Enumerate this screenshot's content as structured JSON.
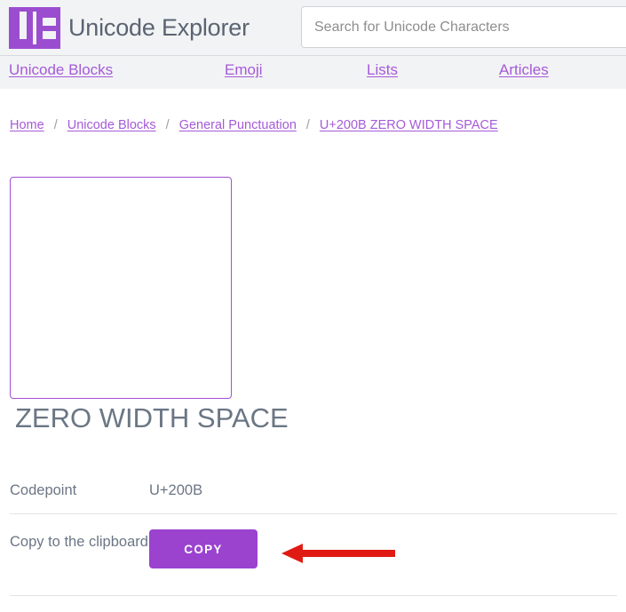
{
  "header": {
    "brand_title": "Unicode Explorer",
    "logo_alt": "UE",
    "search": {
      "placeholder": "Search for Unicode Characters",
      "value": ""
    }
  },
  "nav": {
    "items": [
      {
        "label": "Unicode Blocks"
      },
      {
        "label": "Emoji"
      },
      {
        "label": "Lists"
      },
      {
        "label": "Articles"
      }
    ]
  },
  "breadcrumb": {
    "separator": "/",
    "items": [
      {
        "label": "Home"
      },
      {
        "label": "Unicode Blocks"
      },
      {
        "label": "General Punctuation"
      },
      {
        "label": " U+200B ZERO WIDTH SPACE"
      }
    ]
  },
  "character": {
    "glyph": "",
    "title": "ZERO WIDTH SPACE",
    "properties": [
      {
        "label": "Codepoint",
        "value": "U+200B"
      }
    ],
    "copy": {
      "label": "Copy to the clipboard",
      "button_label": "COPY"
    }
  },
  "annotation": {
    "arrow_color": "#e01b14",
    "arrow_direction": "left",
    "points_at": "copy-button"
  },
  "colors": {
    "accent_purple": "#9b42cf",
    "link_purple": "#a55ad8",
    "header_bg": "#f2f3f5",
    "text_slate": "#6b7685"
  }
}
